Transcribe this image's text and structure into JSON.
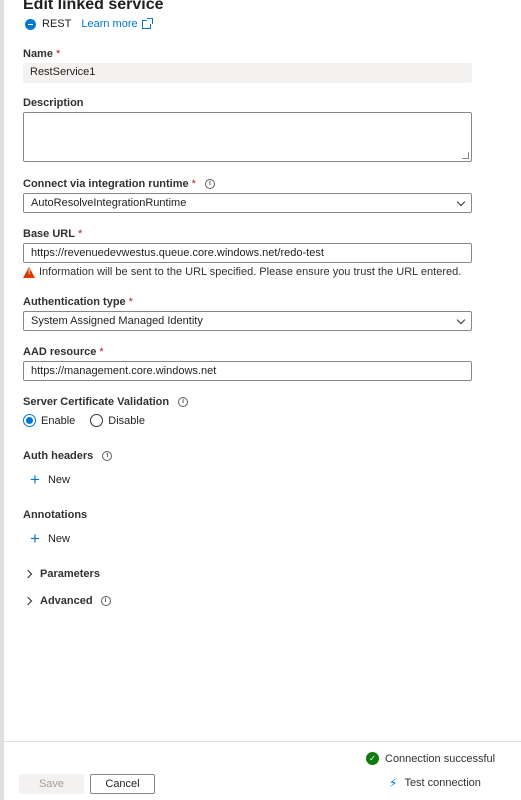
{
  "header": {
    "title": "Edit linked service",
    "service_type": "REST",
    "learn_more": "Learn more"
  },
  "name": {
    "label": "Name",
    "required": "*",
    "value": "RestService1"
  },
  "description": {
    "label": "Description",
    "value": ""
  },
  "runtime": {
    "label": "Connect via integration runtime",
    "required": "*",
    "value": "AutoResolveIntegrationRuntime"
  },
  "base_url": {
    "label": "Base URL",
    "required": "*",
    "value": "https://revenuedevwestus.queue.core.windows.net/redo-test",
    "warning": "Information will be sent to the URL specified. Please ensure you trust the URL entered."
  },
  "auth_type": {
    "label": "Authentication type",
    "required": "*",
    "value": "System Assigned Managed Identity"
  },
  "aad_resource": {
    "label": "AAD resource",
    "required": "*",
    "value": "https://management.core.windows.net"
  },
  "cert_validation": {
    "label": "Server Certificate Validation",
    "options": [
      "Enable",
      "Disable"
    ],
    "selected": "Enable"
  },
  "auth_headers": {
    "label": "Auth headers",
    "new_label": "New"
  },
  "annotations": {
    "label": "Annotations",
    "new_label": "New"
  },
  "sections": {
    "parameters": "Parameters",
    "advanced": "Advanced"
  },
  "footer": {
    "status": "Connection successful",
    "save_label": "Save",
    "cancel_label": "Cancel",
    "test_label": "Test connection"
  },
  "colors": {
    "accent": "#0078d4",
    "success": "#107c10",
    "warning": "#d83b01",
    "required": "#a4262c"
  }
}
